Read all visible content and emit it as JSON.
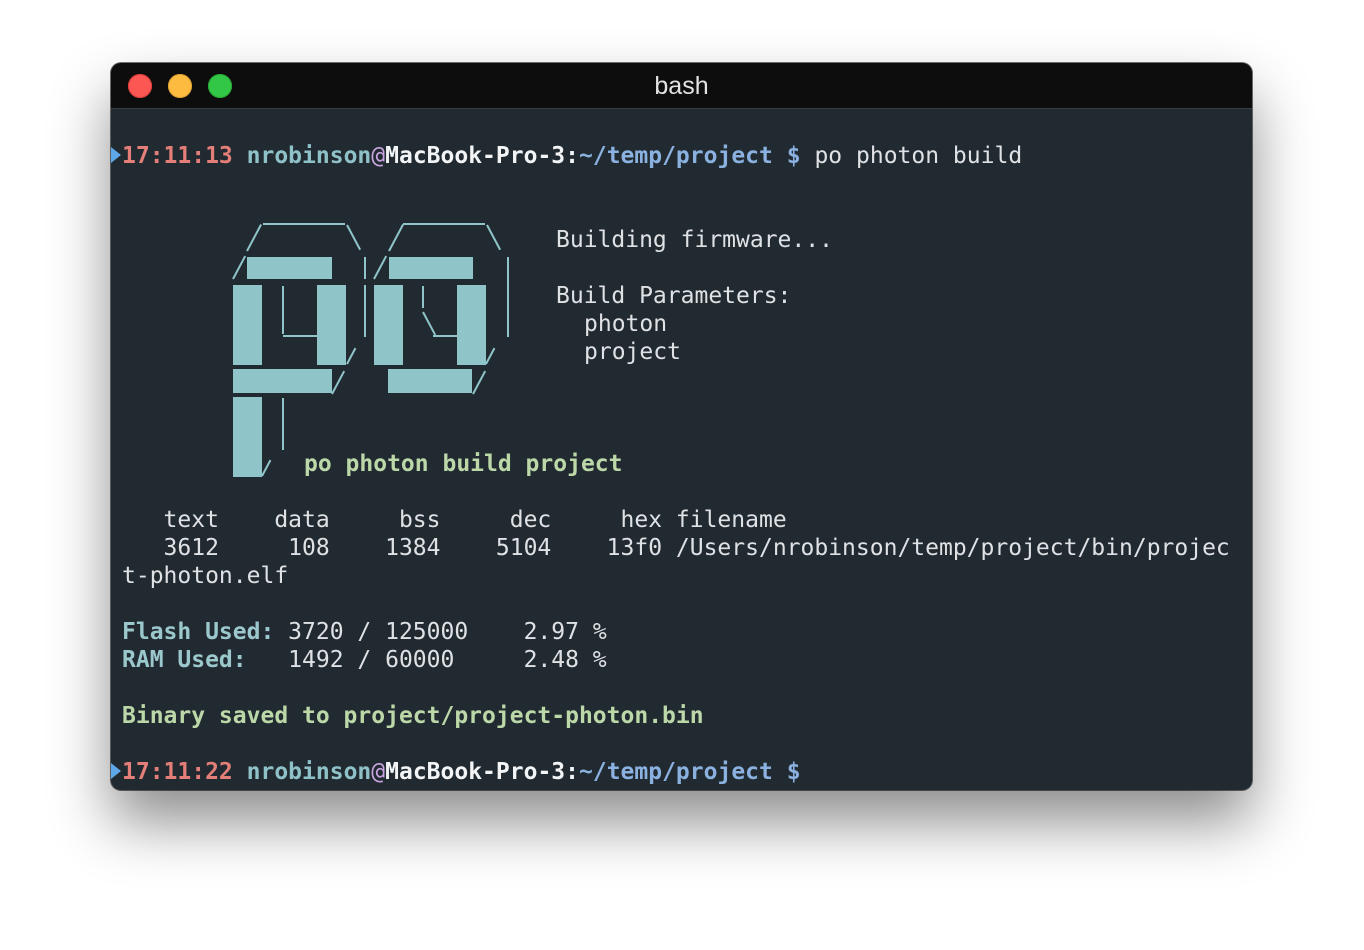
{
  "window": {
    "title": "bash"
  },
  "prompt1": {
    "time": "17:11:13",
    "user": "nrobinson",
    "at": "@",
    "host": "MacBook-Pro-3",
    "colon": ":",
    "path": "~/temp/project",
    "symbol": "$",
    "command": "po photon build"
  },
  "build": {
    "building": "Building firmware...",
    "params_label": "Build Parameters:",
    "param1": "photon",
    "param2": "project",
    "banner": "po photon build project"
  },
  "size_table": {
    "header": "   text    data     bss     dec     hex filename",
    "row": "   3612     108    1384    5104    13f0 /Users/nrobinson/temp/project/bin/projec",
    "row_wrap": "t-photon.elf"
  },
  "usage": {
    "flash_label": "Flash Used:",
    "flash_value": " 3720 / 125000    2.97 %",
    "ram_label": "RAM Used:",
    "ram_value": "   1492 / 60000     2.48 %"
  },
  "result": {
    "message": "Binary saved to project/project-photon.bin"
  },
  "prompt2": {
    "time": "17:11:22",
    "user": "nrobinson",
    "at": "@",
    "host": "MacBook-Pro-3",
    "colon": ":",
    "path": "~/temp/project",
    "symbol": "$"
  },
  "colors": {
    "background": "#222a31",
    "titlebar": "#0d0d0d",
    "time": "#e37f78",
    "user": "#8fc2c8",
    "path": "#8ab1e0",
    "success": "#bcd8a8",
    "logo": "#8fc5c9"
  }
}
